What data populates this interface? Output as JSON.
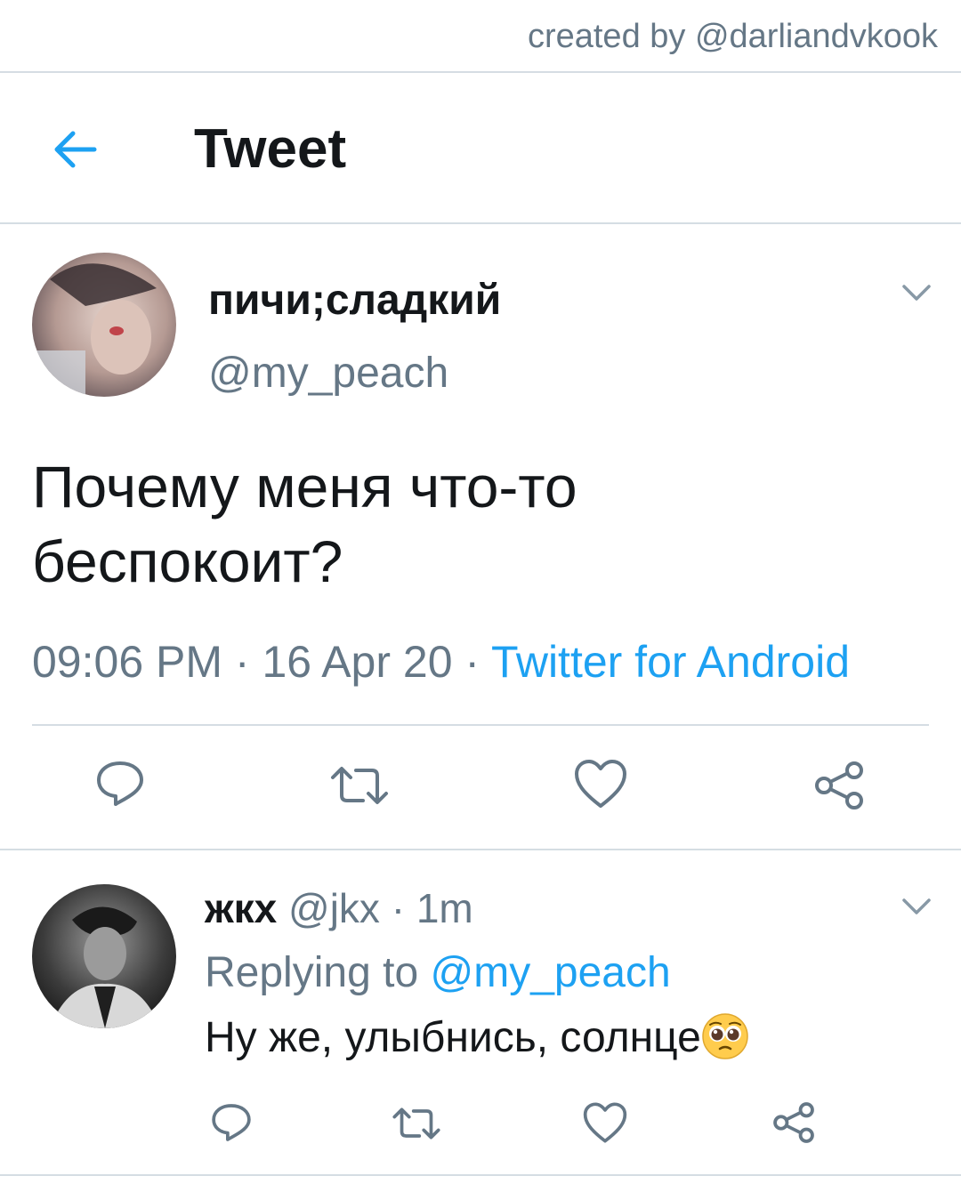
{
  "watermark": "created by @darliandvkook",
  "header": {
    "title": "Tweet",
    "back_icon": "arrow-left-icon"
  },
  "tweet": {
    "display_name": "пичи;сладкий",
    "handle": "@my_peach",
    "text_line1": "Почему меня что-то",
    "text_line2": "беспокоит?",
    "time": "09:06 PM",
    "date": "16 Apr 20",
    "separator": " · ",
    "source": "Twitter for Android"
  },
  "actions": {
    "reply_icon": "reply-icon",
    "retweet_icon": "retweet-icon",
    "like_icon": "heart-icon",
    "share_icon": "share-icon"
  },
  "reply": {
    "display_name": "жкх",
    "handle": "@jkx",
    "age": "1m",
    "replying_label": "Replying to",
    "replying_to": "@my_peach",
    "text": "Ну же, улыбнись, солнце",
    "emoji": "pleading-face-emoji"
  },
  "colors": {
    "accent": "#1da1f2",
    "muted": "#657786",
    "text": "#14171a",
    "divider": "#d5dde3"
  }
}
